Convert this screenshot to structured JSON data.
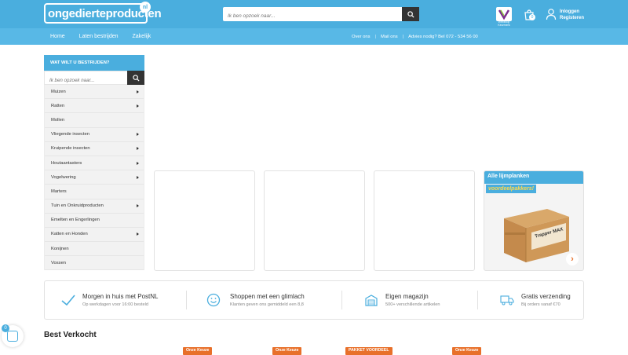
{
  "header": {
    "logo_text": "ongedierteproducten",
    "logo_badge": "nl",
    "search_placeholder": "Ik ben opzoek naar...",
    "webshop_label": "Webshop Keurmerk",
    "cart_count": "0",
    "login_label": "Inloggen",
    "register_label": "Registeren"
  },
  "nav": {
    "left": [
      "Home",
      "Laten bestrijden",
      "Zakelijk"
    ],
    "right": {
      "about": "Over ons",
      "mail": "Mail ons",
      "advice": "Advies nodig? Bel 072 - 534 56 00"
    }
  },
  "sidebar": {
    "heading": "WAT WILT U BESTRIJDEN?",
    "search_placeholder": "Ik ben opzoek naar...",
    "items": [
      {
        "label": "Muizen",
        "has_sub": true
      },
      {
        "label": "Ratten",
        "has_sub": true
      },
      {
        "label": "Mollen",
        "has_sub": false
      },
      {
        "label": "Vliegende insecten",
        "has_sub": true
      },
      {
        "label": "Kruipende insecten",
        "has_sub": true
      },
      {
        "label": "Houtaantasters",
        "has_sub": true
      },
      {
        "label": "Vogelwering",
        "has_sub": true
      },
      {
        "label": "Marters",
        "has_sub": false
      },
      {
        "label": "Tuin en Onkruidproducten",
        "has_sub": true
      },
      {
        "label": "Emelten en Engerlingen",
        "has_sub": false
      },
      {
        "label": "Katten en Honden",
        "has_sub": true
      },
      {
        "label": "Konijnen",
        "has_sub": false
      },
      {
        "label": "Vossen",
        "has_sub": false
      }
    ]
  },
  "promo": {
    "title": "Alle lijmplanken",
    "subtitle": "voordeelpakkers!",
    "box_brand": "Trapper MAX"
  },
  "usps": [
    {
      "title": "Morgen in huis met PostNL",
      "sub": "Op werkdagen voor 16:00 besteld",
      "icon": "check-icon"
    },
    {
      "title": "Shoppen met een glimlach",
      "sub": "Klanten geven ons gemiddeld een 8,8",
      "icon": "smiley-icon"
    },
    {
      "title": "Eigen magazijn",
      "sub": "500+ verschillende artikelen",
      "icon": "warehouse-icon"
    },
    {
      "title": "Gratis verzending",
      "sub": "Bij orders vanaf €70",
      "icon": "truck-icon"
    }
  ],
  "best_sold": {
    "heading": "Best Verkocht",
    "tags": [
      "Onze Keuze",
      "Onze Keuze",
      "PAKKET VOORDEEL",
      "Onze Keuze"
    ]
  },
  "chat": {
    "badge": "0"
  },
  "colors": {
    "brand": "#4aaede",
    "accent": "#e8702a",
    "dark": "#333333"
  }
}
